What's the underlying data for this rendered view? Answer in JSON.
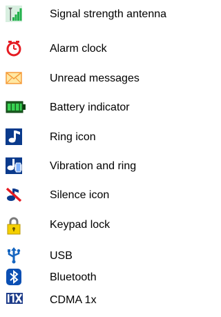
{
  "legend": {
    "items": [
      {
        "icon": "signal-strength-icon",
        "label": "Signal strength antenna"
      },
      {
        "icon": "alarm-clock-icon",
        "label": "Alarm clock"
      },
      {
        "icon": "envelope-icon",
        "label": "Unread messages"
      },
      {
        "icon": "battery-icon",
        "label": "Battery indicator"
      },
      {
        "icon": "ring-icon",
        "label": "Ring icon"
      },
      {
        "icon": "vibration-ring-icon",
        "label": "Vibration and ring"
      },
      {
        "icon": "silence-icon",
        "label": "Silence icon"
      },
      {
        "icon": "padlock-icon",
        "label": "Keypad lock"
      },
      {
        "icon": "usb-icon",
        "label": "USB"
      },
      {
        "icon": "bluetooth-icon",
        "label": "Bluetooth"
      },
      {
        "icon": "cdma-1x-icon",
        "label": "CDMA 1x"
      }
    ]
  }
}
